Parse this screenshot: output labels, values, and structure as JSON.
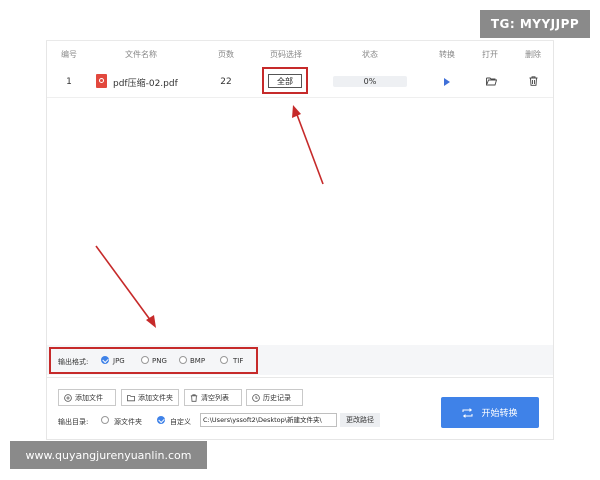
{
  "watermarks": {
    "tg": "TG: MYYJJPP",
    "url": "www.quyangjurenyuanlin.com"
  },
  "table": {
    "headers": [
      "编号",
      "文件名称",
      "页数",
      "页码选择",
      "状态",
      "转换",
      "打开",
      "删除"
    ],
    "rows": [
      {
        "index": "1",
        "filename": "pdf压缩-02.pdf",
        "pages": "22",
        "page_select": "全部",
        "progress_text": "0%",
        "progress": 0
      }
    ]
  },
  "format": {
    "label": "输出格式:",
    "options": [
      "JPG",
      "PNG",
      "BMP",
      "TIF"
    ],
    "selected": "JPG"
  },
  "toolbar": {
    "add_file": "添加文件",
    "add_folder": "添加文件夹",
    "clear_list": "清空列表",
    "history": "历史记录"
  },
  "output": {
    "label": "输出目录:",
    "option_source": "源文件夹",
    "option_custom": "自定义",
    "selected": "自定义",
    "path": "C:\\Users\\yssoft2\\Desktop\\新建文件夹\\",
    "change_path": "更改路径"
  },
  "start_button": "开始转换",
  "colors": {
    "accent": "#3f82e8",
    "annotation_red": "#c62a2a",
    "pdf_red": "#e2483d"
  },
  "icons": {
    "file": "pdf-file-icon",
    "convert": "play-icon",
    "open": "folder-open-icon",
    "delete": "trash-icon",
    "start": "swap-arrows-icon"
  }
}
